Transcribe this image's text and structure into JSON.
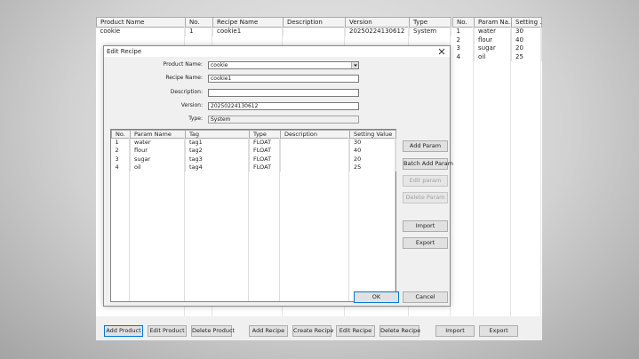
{
  "main": {
    "products": {
      "columns": [
        "Product Name",
        "No.",
        "Recipe Name",
        "Description",
        "Version",
        "Type"
      ],
      "rows": [
        [
          "cookie",
          "1",
          "cookie1",
          "",
          "20250224130612",
          "System"
        ]
      ]
    },
    "params": {
      "columns": [
        "No.",
        "Param Na...",
        "Setting ..."
      ],
      "rows": [
        [
          "1",
          "water",
          "30"
        ],
        [
          "2",
          "flour",
          "40"
        ],
        [
          "3",
          "sugar",
          "20"
        ],
        [
          "4",
          "oil",
          "25"
        ]
      ]
    },
    "buttons": {
      "add_product": "Add Product",
      "edit_product": "Edit Product",
      "delete_product": "Delete Product",
      "add_recipe": "Add Recipe",
      "create_recipe": "Create Recipe",
      "edit_recipe": "Edit Recipe",
      "delete_recipe": "Delete Recipe",
      "import": "Import",
      "export": "Export"
    }
  },
  "dialog": {
    "title": "Edit Recipe",
    "fields": {
      "product_name_label": "Product Name:",
      "product_name_value": "cookie",
      "recipe_name_label": "Recipe Name:",
      "recipe_name_value": "cookie1",
      "description_label": "Description:",
      "description_value": "",
      "version_label": "Version:",
      "version_value": "20250224130612",
      "type_label": "Type:",
      "type_value": "System"
    },
    "grid": {
      "columns": [
        "No.",
        "Param Name",
        "Tag",
        "Type",
        "Description",
        "Setting Value"
      ],
      "rows": [
        [
          "1",
          "water",
          "tag1",
          "FLOAT",
          "",
          "30"
        ],
        [
          "2",
          "flour",
          "tag2",
          "FLOAT",
          "",
          "40"
        ],
        [
          "3",
          "sugar",
          "tag3",
          "FLOAT",
          "",
          "20"
        ],
        [
          "4",
          "oil",
          "tag4",
          "FLOAT",
          "",
          "25"
        ]
      ]
    },
    "buttons": {
      "add_param": "Add Param",
      "batch_add_param": "Batch Add Param",
      "edit_param": "Edit param",
      "delete_param": "Delete Param",
      "import": "Import",
      "export": "Export",
      "ok": "OK",
      "cancel": "Cancel"
    }
  },
  "icons": {
    "close": "close-icon",
    "dropdown": "chevron-down-icon"
  },
  "colors": {
    "focus_border": "#0078d7",
    "disabled_text": "#a0a0a0"
  }
}
